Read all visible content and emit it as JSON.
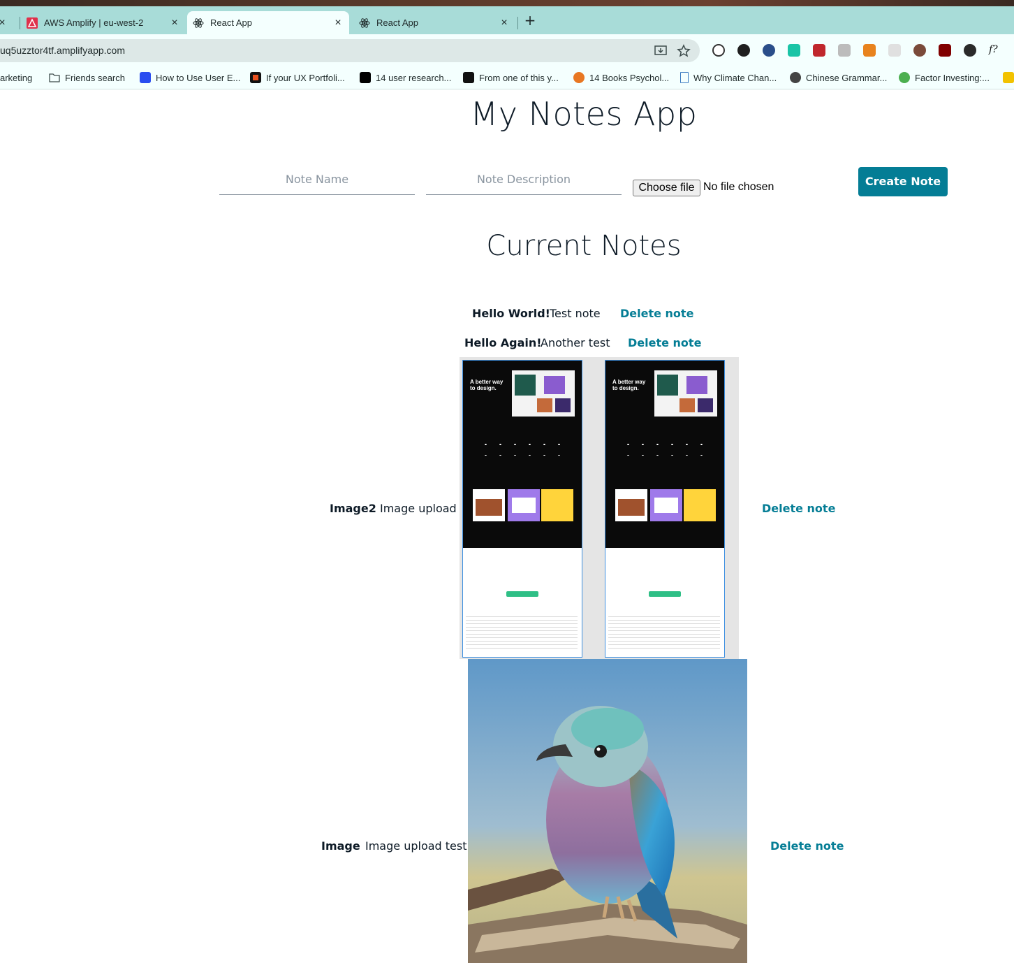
{
  "browser": {
    "tabs": [
      {
        "title": "AWS Amplify | eu-west-2",
        "icon": "aws-amplify-icon",
        "active": false
      },
      {
        "title": "React App",
        "icon": "react-icon",
        "active": true
      },
      {
        "title": "React App",
        "icon": "react-icon",
        "active": false
      }
    ],
    "new_tab": "+",
    "close_glyph": "×",
    "url": "uq5uzztor4tf.amplifyapp.com",
    "bookmarks": [
      {
        "label": "arketing",
        "icon": "none"
      },
      {
        "label": "Friends search",
        "icon": "folder-icon"
      },
      {
        "label": "How to Use User E...",
        "icon": "bookmark-blue-icon"
      },
      {
        "label": "If your UX Portfoli...",
        "icon": "bookmark-red-icon"
      },
      {
        "label": "14 user research...",
        "icon": "medium-icon"
      },
      {
        "label": "From one of this y...",
        "icon": "sw-icon"
      },
      {
        "label": "14 Books Psychol...",
        "icon": "bookmark-orange-icon"
      },
      {
        "label": "Why Climate Chan...",
        "icon": "page-icon"
      },
      {
        "label": "Chinese Grammar...",
        "icon": "globe-icon"
      },
      {
        "label": "Factor Investing:...",
        "icon": "bookmark-green-icon"
      }
    ]
  },
  "app": {
    "title": "My Notes App",
    "form": {
      "name_placeholder": "Note Name",
      "description_placeholder": "Note Description",
      "file_button": "Choose file",
      "file_status": "No file chosen",
      "create_button": "Create Note"
    },
    "section_title": "Current Notes",
    "notes": [
      {
        "name": "Hello World!",
        "description": "Test note",
        "delete": "Delete note",
        "image": null
      },
      {
        "name": "Hello Again!",
        "description": "Another test",
        "delete": "Delete note",
        "image": null
      },
      {
        "name": "Image2",
        "description": "Image upload",
        "delete": "Delete note",
        "image": "figma-landing-page-screenshot"
      },
      {
        "name": "Image",
        "description": "Image upload test",
        "delete": "Delete note",
        "image": "lilac-breasted-roller-bird-photo"
      }
    ],
    "mockup_text": "A better way to design."
  },
  "colors": {
    "accent": "#047d95",
    "text": "#0d1a26",
    "tabbar": "#a8dcd8"
  }
}
